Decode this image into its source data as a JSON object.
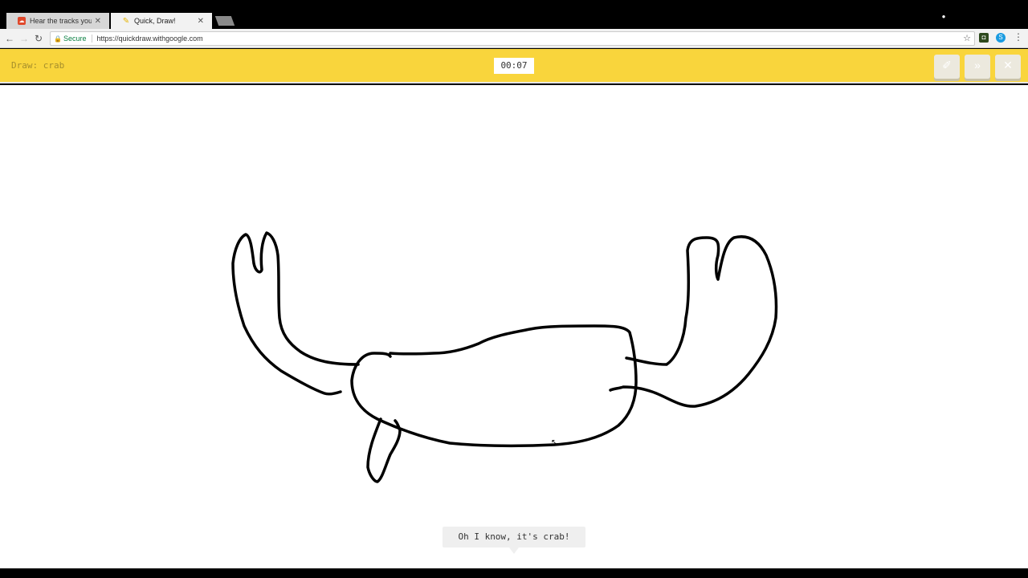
{
  "browser": {
    "tabs": [
      {
        "title": "Hear the tracks you've li",
        "active": false
      },
      {
        "title": "Quick, Draw!",
        "active": true
      }
    ],
    "omnibox": {
      "secure_label": "Secure",
      "url": "https://quickdraw.withgoogle.com"
    }
  },
  "game": {
    "prompt": "Draw: crab",
    "timer": "00:07",
    "guess_message": "Oh I know, it's crab!"
  },
  "icons": {
    "clear": "eraser-icon",
    "skip": "skip-icon",
    "close": "close-icon"
  },
  "colors": {
    "header": "#f9d53c",
    "ink": "#000000"
  }
}
